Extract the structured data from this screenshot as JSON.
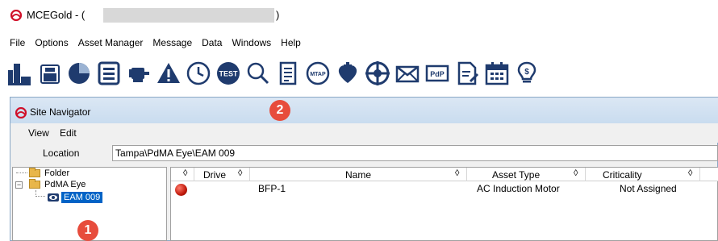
{
  "window": {
    "title": "MCEGold -",
    "title_paren_open": "(",
    "title_paren_close": ")"
  },
  "menu": [
    "File",
    "Options",
    "Asset Manager",
    "Message",
    "Data",
    "Windows",
    "Help"
  ],
  "toolbar": {
    "icons": [
      "equipment-icon",
      "printer-icon",
      "pie-chart-icon",
      "list-icon",
      "motor-icon",
      "warning-icon",
      "clock-icon",
      "test-icon",
      "search-icon",
      "notepad-icon",
      "mtap-icon",
      "heart-icon",
      "target-icon",
      "envelope-icon",
      "pdp-icon",
      "document-edit-icon",
      "calendar-icon",
      "bulb-dollar-icon"
    ],
    "test_label": "TEST",
    "mtap_label": "MTAP",
    "pdp_label": "PdP",
    "accent": "#1f3b6e"
  },
  "site_navigator": {
    "title": "Site Navigator",
    "menu": [
      "View",
      "Edit"
    ],
    "location_label": "Location",
    "location_value": "Tampa\\PdMA Eye\\EAM 009",
    "tree": {
      "folder": "Folder",
      "site": "PdMA Eye",
      "selected": "EAM 009"
    },
    "grid": {
      "columns": [
        "Drive",
        "Name",
        "Asset Type",
        "Criticality"
      ],
      "sort_glyph": "◊",
      "rows": [
        {
          "status": "red",
          "drive": "",
          "name": "BFP-1",
          "asset_type": "AC Induction Motor",
          "criticality": "Not Assigned"
        }
      ]
    }
  },
  "callouts": [
    "1",
    "2"
  ],
  "colors": {
    "callout": "#e74c3c",
    "selection": "#0063c6",
    "status_red": "#c01a0c"
  }
}
